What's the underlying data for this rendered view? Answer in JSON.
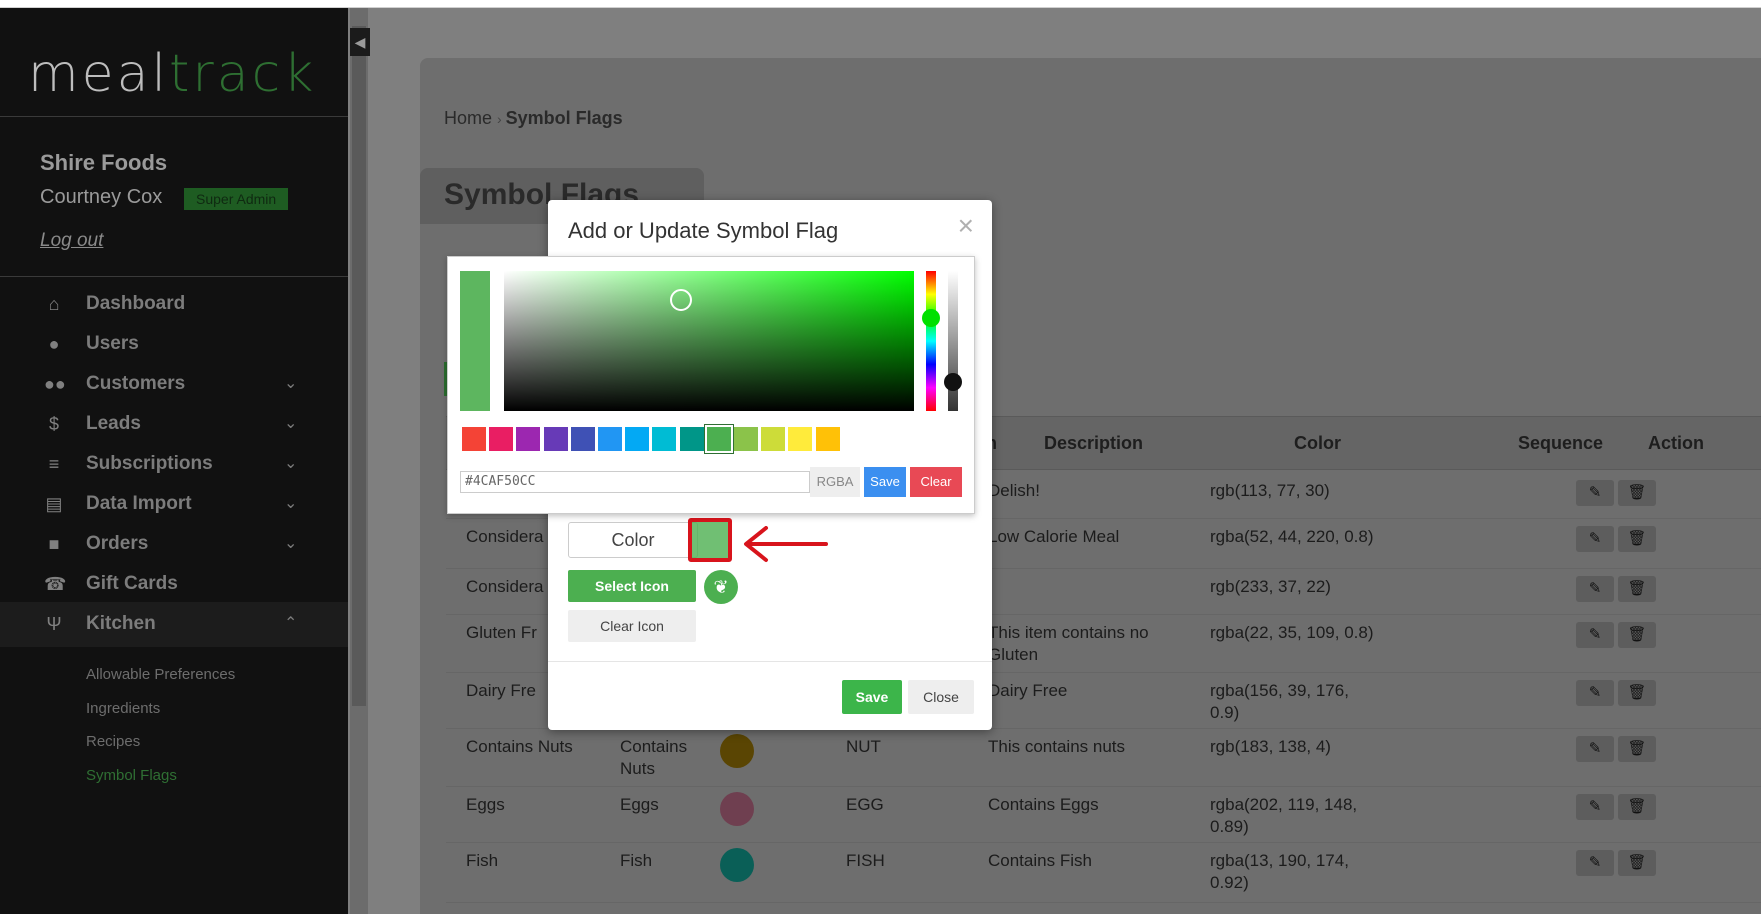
{
  "app": {
    "logo_main": "meal",
    "logo_accent": "track"
  },
  "sidebar": {
    "company": "Shire Foods",
    "user_name": "Courtney Cox",
    "role_badge": "Super Admin",
    "logout_label": "Log out",
    "items": [
      {
        "label": "Dashboard",
        "icon": "home-icon"
      },
      {
        "label": "Users",
        "icon": "user-icon"
      },
      {
        "label": "Customers",
        "icon": "users-icon"
      },
      {
        "label": "Leads",
        "icon": "dollar-icon"
      },
      {
        "label": "Subscriptions",
        "icon": "layers-icon"
      },
      {
        "label": "Data Import",
        "icon": "file-icon"
      },
      {
        "label": "Orders",
        "icon": "bag-icon"
      },
      {
        "label": "Gift Cards",
        "icon": "phone-icon"
      },
      {
        "label": "Kitchen",
        "icon": "utensils-icon"
      }
    ],
    "kitchen_sub": [
      "Allowable Preferences",
      "Ingredients",
      "Recipes",
      "Symbol Flags"
    ]
  },
  "breadcrumb": {
    "home": "Home",
    "current": "Symbol Flags"
  },
  "page": {
    "title": "Symbol Flags"
  },
  "table": {
    "headers": {
      "n": "n",
      "description": "Description",
      "color": "Color",
      "sequence": "Sequence",
      "action": "Action"
    },
    "rows": [
      {
        "name": "",
        "label": "",
        "code": "",
        "description": "Delish!",
        "color": "rgb(113, 77, 30)",
        "swatch": ""
      },
      {
        "name": "Considera",
        "label": "",
        "code": "",
        "description": "Low Calorie Meal",
        "color": "rgba(52, 44, 220, 0.8)",
        "swatch": ""
      },
      {
        "name": "Considera",
        "label": "",
        "code": "",
        "description": "",
        "color": "rgb(233, 37, 22)",
        "swatch": ""
      },
      {
        "name": "Gluten Fr",
        "label": "",
        "code": "",
        "description": "This item contains no\nGluten",
        "color": "rgba(22, 35, 109, 0.8)",
        "swatch": ""
      },
      {
        "name": "Dairy Fre",
        "label": "",
        "code": "",
        "description": "Dairy Free",
        "color": "rgba(156, 39, 176,\n0.9)",
        "swatch": ""
      },
      {
        "name": "Contains Nuts",
        "label": "Contains\nNuts",
        "code": "NUT",
        "description": "This contains nuts",
        "color": "rgb(183, 138, 4)",
        "swatch": "#5a4503"
      },
      {
        "name": "Eggs",
        "label": "Eggs",
        "code": "EGG",
        "description": "Contains Eggs",
        "color": "rgba(202, 119, 148,\n0.89)",
        "swatch": "#6f3f50"
      },
      {
        "name": "Fish",
        "label": "Fish",
        "code": "FISH",
        "description": "Contains Fish",
        "color": "rgba(13, 190, 174,\n0.92)",
        "swatch": "#0a5f57"
      }
    ]
  },
  "modal": {
    "title": "Add or Update Symbol Flag",
    "color_label": "Color",
    "select_icon_label": "Select Icon",
    "clear_icon_label": "Clear Icon",
    "save_label": "Save",
    "close_label": "Close"
  },
  "picker": {
    "hex_value": "#4CAF50CC",
    "format_label": "RGBA",
    "save_label": "Save",
    "clear_label": "Clear",
    "presets": [
      "#f44336",
      "#e91e63",
      "#9c27b0",
      "#673ab7",
      "#3f51b5",
      "#2196f3",
      "#03a9f4",
      "#00bcd4",
      "#009688",
      "#4caf50",
      "#8bc34a",
      "#cddc39",
      "#ffeb3b",
      "#ffc107"
    ],
    "selected_preset": "#4caf50"
  },
  "colors": {
    "accent": "#4caf50",
    "danger": "#e84955",
    "primary": "#3b8ff0",
    "annotation": "#d8141c"
  }
}
